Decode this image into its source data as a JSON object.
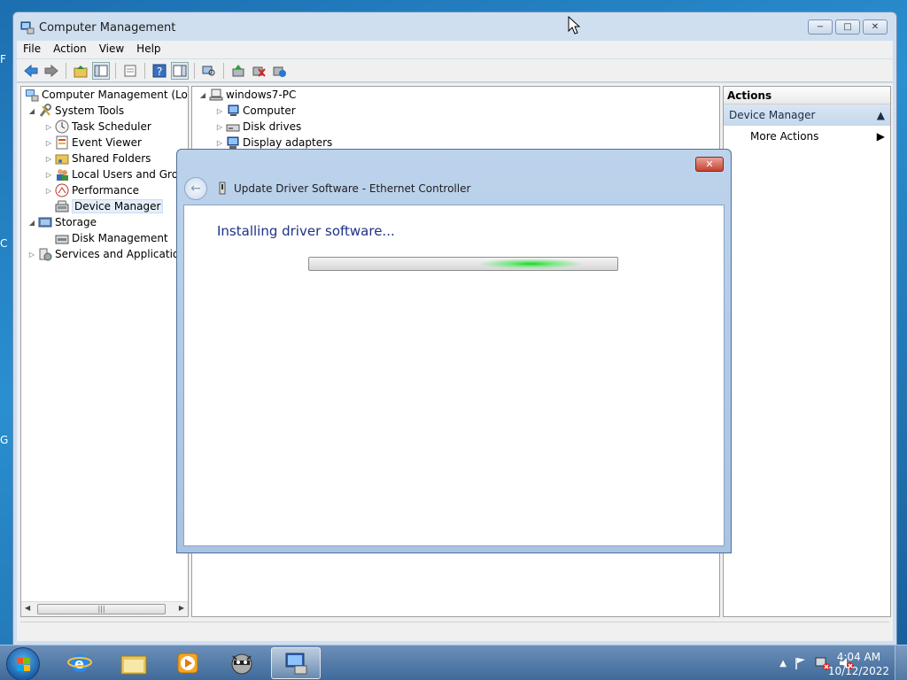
{
  "window": {
    "title": "Computer Management",
    "buttons": {
      "minimize": "−",
      "maximize": "□",
      "close": "✕"
    }
  },
  "menu": [
    "File",
    "Action",
    "View",
    "Help"
  ],
  "tree": {
    "root": "Computer Management (Local",
    "system_tools": "System Tools",
    "task_scheduler": "Task Scheduler",
    "event_viewer": "Event Viewer",
    "shared_folders": "Shared Folders",
    "local_users": "Local Users and Group",
    "performance": "Performance",
    "device_manager": "Device Manager",
    "storage": "Storage",
    "disk_management": "Disk Management",
    "services": "Services and Applications"
  },
  "devices": {
    "host": "windows7-PC",
    "items": [
      "Computer",
      "Disk drives",
      "Display adapters"
    ]
  },
  "actions": {
    "header": "Actions",
    "section": "Device Manager",
    "more": "More Actions"
  },
  "dialog": {
    "title": "Update Driver Software - Ethernet Controller",
    "close": "✕",
    "message": "Installing driver software...",
    "progress_state": "indeterminate"
  },
  "taskbar": {
    "time": "4:04 AM",
    "date": "10/12/2022"
  },
  "colors": {
    "progress_glow": "#1bd427",
    "message_text": "#1e3287",
    "close_button": "#c5412e"
  }
}
